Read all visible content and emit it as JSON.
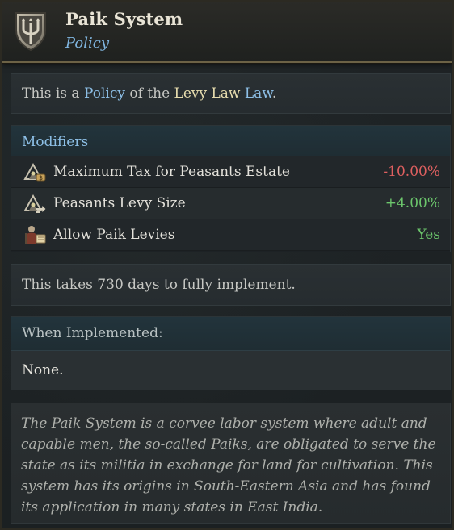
{
  "header": {
    "title": "Paik System",
    "subtitle": "Policy",
    "icon": "shield-trident-icon"
  },
  "intro": {
    "prefix": "This is a ",
    "policy_word": "Policy",
    "middle": " of the ",
    "law_name": "Levy Law",
    "law_word": " Law",
    "suffix": "."
  },
  "modifiers": {
    "heading": "Modifiers",
    "items": [
      {
        "label": "Maximum Tax for Peasants Estate",
        "value": "-10.00%",
        "tone": "negative",
        "icon": "peasants-estate-tax-icon"
      },
      {
        "label": "Peasants Levy Size",
        "value": "+4.00%",
        "tone": "positive",
        "icon": "peasants-levy-icon"
      },
      {
        "label": "Allow Paik Levies",
        "value": "Yes",
        "tone": "positive",
        "icon": "soldier-scroll-icon"
      }
    ]
  },
  "implementation": {
    "text": "This takes 730 days to fully implement."
  },
  "when_implemented": {
    "heading": "When Implemented:",
    "value": "None."
  },
  "flavor": {
    "text": "The Paik System is a corvee labor system where adult and capable men, the so-called Paiks, are obligated to serve the state as its militia in exchange for land for cultivation. This system has its origins in South-Eastern Asia and has found its application in many states in East India."
  },
  "colors": {
    "accent_blue": "#8dbfe6",
    "negative": "#e06060",
    "positive": "#6cc66c",
    "gold_text": "#e6dcae"
  }
}
